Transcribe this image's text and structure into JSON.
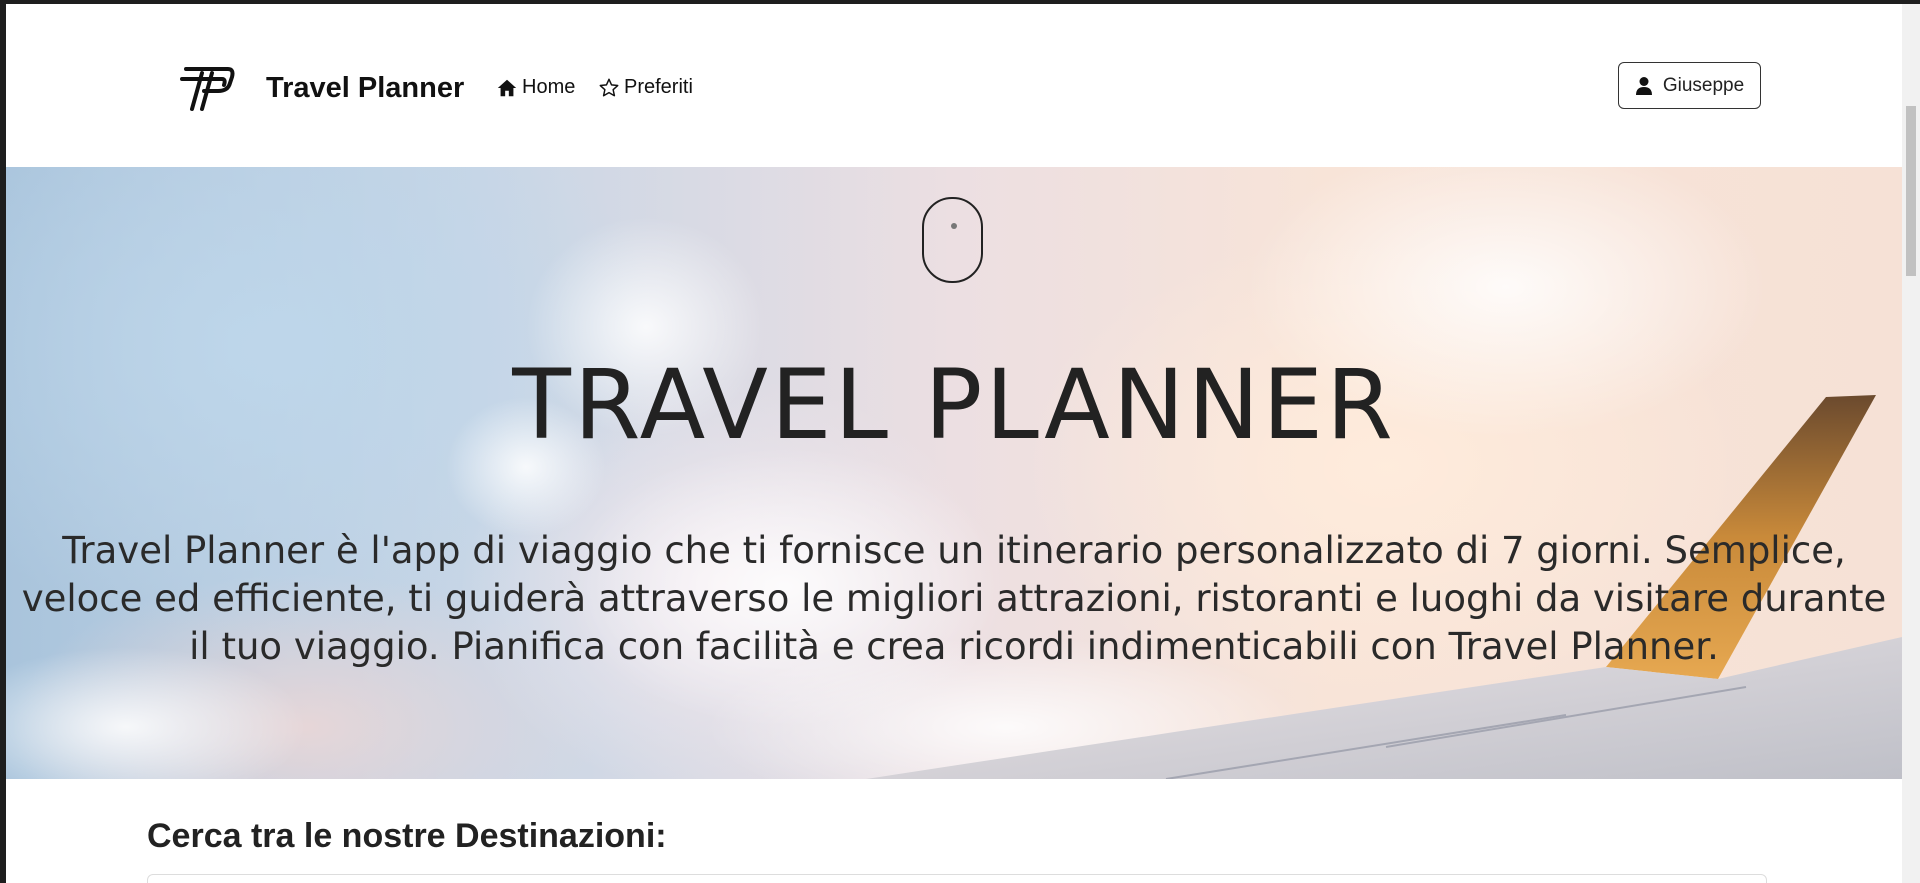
{
  "navbar": {
    "brand": "Travel Planner",
    "links": [
      {
        "label": "Home",
        "icon": "home-icon"
      },
      {
        "label": "Preferiti",
        "icon": "star-outline-icon"
      }
    ],
    "user_button": {
      "label": "Giuseppe",
      "icon": "user-icon"
    }
  },
  "hero": {
    "scroll_icon": "mouse-scroll-icon",
    "title": "TRAVEL PLANNER",
    "description": "Travel Planner è l'app di viaggio che ti fornisce un itinerario personalizzato di 7 giorni. Semplice, veloce ed efficiente, ti guiderà attraverso le migliori attrazioni, ristoranti e luoghi da visitare durante il tuo viaggio. Pianifica con facilità e crea ricordi indimenticabili con Travel Planner."
  },
  "search": {
    "title": "Cerca tra le nostre Destinazioni:"
  },
  "colors": {
    "text": "#222222",
    "background": "#ffffff",
    "wing": "#c58a3c"
  }
}
